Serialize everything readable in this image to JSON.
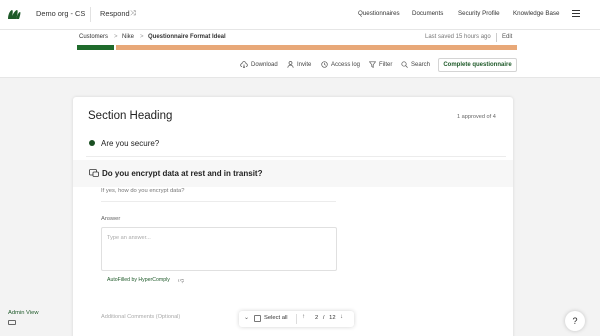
{
  "topnav": {
    "org_name": "Demo org - CS",
    "mode": "Respond",
    "links": [
      "Questionnaires",
      "Documents",
      "Security Profile",
      "Knowledge Base"
    ]
  },
  "breadcrumb": {
    "items": [
      "Customers",
      "Nike",
      "Questionnaire Format Ideal"
    ],
    "separator": ">",
    "last_saved": "Last saved 15 hours ago",
    "edit_label": "Edit"
  },
  "progress": {
    "approved_fraction": 0.085,
    "bar_color": "#e8a878",
    "done_color": "#1f6b2c"
  },
  "toolbar": {
    "download": "Download",
    "invite": "Invite",
    "access_log": "Access log",
    "filter": "Filter",
    "search": "Search",
    "complete": "Complete questionnaire"
  },
  "section": {
    "heading": "Section Heading",
    "approved": "1 approved of 4",
    "q1": "Are you secure?",
    "q2": "Do you encrypt data at rest and in transit?",
    "sub_question": "If yes, how do you encrypt data?",
    "answer_label": "Answer",
    "answer_placeholder": "Type an answer...",
    "autofill": "AutoFilled by HyperComply",
    "additional_comments": "Additional Comments (Optional)"
  },
  "pager": {
    "select_all": "Select all",
    "current": "2",
    "separator": "/",
    "total": "12"
  },
  "admin_view": "Admin View",
  "help": "?",
  "colors": {
    "accent": "#1f5a2a",
    "pending": "#e8a878"
  }
}
